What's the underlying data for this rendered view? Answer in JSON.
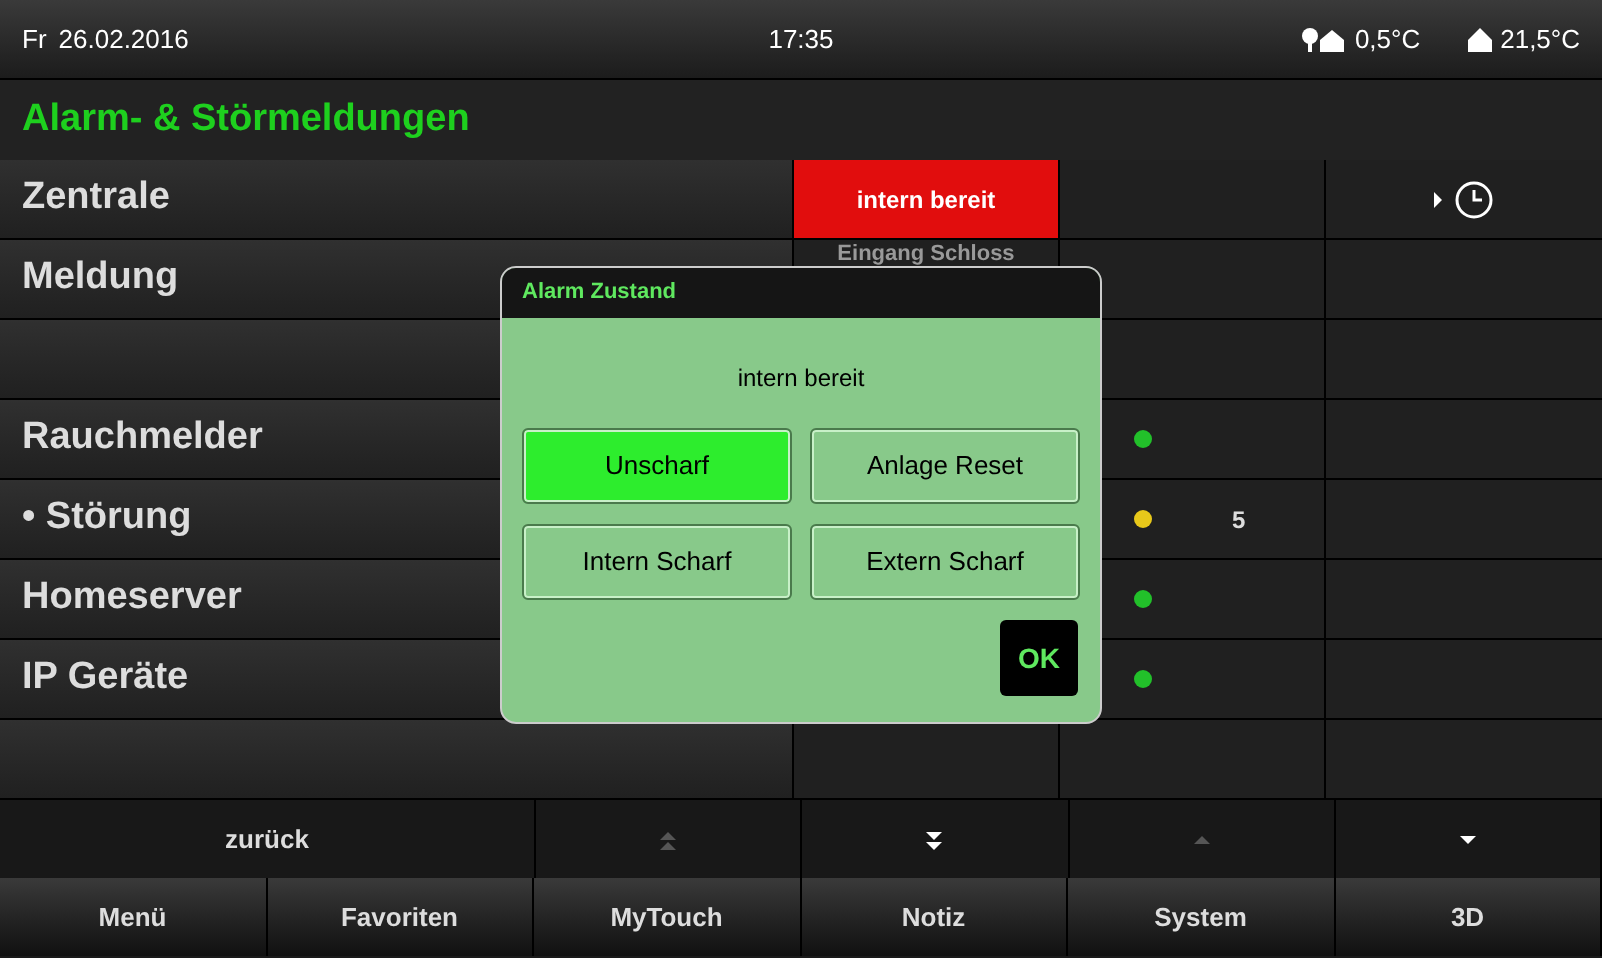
{
  "status_bar": {
    "day": "Fr",
    "date": "26.02.2016",
    "time": "17:35",
    "outdoor_temp": "0,5°C",
    "indoor_temp": "21,5°C"
  },
  "title": "Alarm- & Störmeldungen",
  "rows": [
    {
      "label": "Zentrale",
      "state": "intern bereit",
      "state_alarm": true,
      "history": true
    },
    {
      "label": "Meldung",
      "state": "Eingang Schloss"
    },
    {},
    {
      "label": "Rauchmelder",
      "color": "#22c02a"
    },
    {
      "label": "• Störung",
      "color": "#e8c81a",
      "count": "5"
    },
    {
      "label": "Homeserver",
      "color": "#22c02a"
    },
    {
      "label": "IP Geräte",
      "color": "#22c02a"
    },
    {}
  ],
  "nav": [
    {
      "kind": "text",
      "label": "zurück",
      "disabled": false
    },
    {
      "kind": "double_up",
      "disabled": true
    },
    {
      "kind": "double_down",
      "disabled": false
    },
    {
      "kind": "up",
      "disabled": true
    },
    {
      "kind": "down",
      "disabled": false
    }
  ],
  "dialog": {
    "title": "Alarm Zustand",
    "message": "intern bereit",
    "buttons": [
      {
        "label": "Unscharf",
        "selected": true
      },
      {
        "label": "Anlage Reset",
        "selected": false
      },
      {
        "label": "Intern Scharf",
        "selected": false
      },
      {
        "label": "Extern Scharf",
        "selected": false
      }
    ],
    "ok": "OK"
  },
  "tabs": [
    {
      "label": "Menü"
    },
    {
      "label": "Favoriten"
    },
    {
      "label": "MyTouch"
    },
    {
      "label": "Notiz"
    },
    {
      "label": "System"
    },
    {
      "label": "3D"
    }
  ]
}
